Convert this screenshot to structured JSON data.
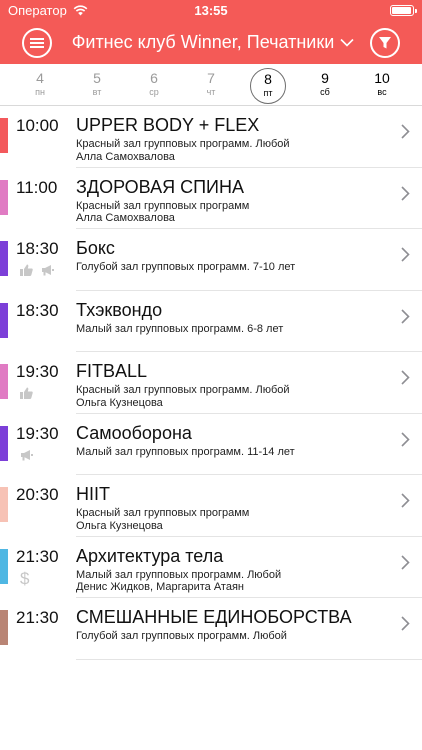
{
  "status": {
    "carrier": "Оператор",
    "time": "13:55"
  },
  "header": {
    "club_title": "Фитнес клуб Winner, Печатники"
  },
  "days": [
    {
      "num": "4",
      "dow": "пн",
      "state": "past"
    },
    {
      "num": "5",
      "dow": "вт",
      "state": "past"
    },
    {
      "num": "6",
      "dow": "ср",
      "state": "past"
    },
    {
      "num": "7",
      "dow": "чт",
      "state": "past"
    },
    {
      "num": "8",
      "dow": "пт",
      "state": "selected"
    },
    {
      "num": "9",
      "dow": "сб",
      "state": "future"
    },
    {
      "num": "10",
      "dow": "вс",
      "state": "future"
    }
  ],
  "classes": [
    {
      "time": "10:00",
      "title": "UPPER BODY + FLEX",
      "line1": "Красный зал групповых программ. Любой",
      "line2": "Алла Самохвалова",
      "color": "#f3595c",
      "icons": []
    },
    {
      "time": "11:00",
      "title": "ЗДОРОВАЯ СПИНА",
      "line1": "Красный зал групповых программ",
      "line2": "Алла Самохвалова",
      "color": "#e07bc3",
      "icons": []
    },
    {
      "time": "18:30",
      "title": "Бокс",
      "line1": "Голубой зал групповых программ. 7-10 лет",
      "line2": "",
      "color": "#7c3fd8",
      "icons": [
        "thumb-up-icon",
        "megaphone-icon"
      ]
    },
    {
      "time": "18:30",
      "title": "Тхэквондо",
      "line1": "Малый зал групповых программ. 6-8 лет",
      "line2": "",
      "color": "#7c3fd8",
      "icons": []
    },
    {
      "time": "19:30",
      "title": "FITBALL",
      "line1": "Красный зал групповых программ. Любой",
      "line2": "Ольга Кузнецова",
      "color": "#e07bc3",
      "icons": [
        "thumb-up-icon"
      ]
    },
    {
      "time": "19:30",
      "title": "Самооборона",
      "line1": "Малый зал групповых программ. 11-14 лет",
      "line2": "",
      "color": "#7c3fd8",
      "icons": [
        "megaphone-icon"
      ]
    },
    {
      "time": "20:30",
      "title": "HIIT",
      "line1": "Красный зал групповых программ",
      "line2": "Ольга Кузнецова",
      "color": "#f7c2b5",
      "icons": []
    },
    {
      "time": "21:30",
      "title": "Архитектура тела",
      "line1": "Малый зал групповых программ. Любой",
      "line2": "Денис Жидков, Маргарита Атаян",
      "color": "#4fb7e3",
      "icons": [
        "dollar-icon"
      ]
    },
    {
      "time": "21:30",
      "title": "СМЕШАННЫЕ ЕДИНОБОРСТВА",
      "line1": "Голубой зал групповых программ. Любой",
      "line2": "",
      "color": "#b98575",
      "icons": []
    }
  ]
}
